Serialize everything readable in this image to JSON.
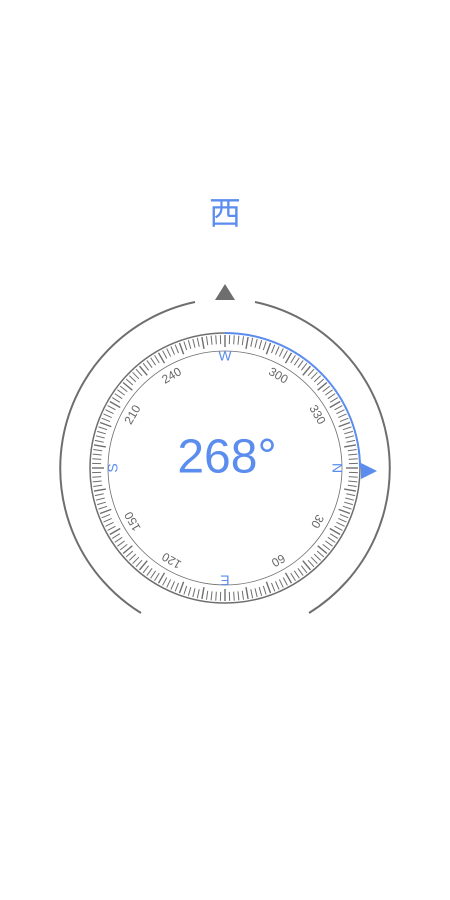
{
  "compass": {
    "direction_label": "西",
    "heading_degrees": 268,
    "heading_text": "268°",
    "cardinals": {
      "north": "N",
      "east": "E",
      "south": "S",
      "west": "W"
    },
    "degree_labels": [
      "30",
      "60",
      "120",
      "150",
      "210",
      "240",
      "300",
      "330"
    ],
    "colors": {
      "accent": "#5b8def",
      "ring": "#6e6e6e",
      "tick": "#6e6e6e",
      "label": "#666666",
      "pointer": "#6e6e6e"
    },
    "icons": {
      "top_pointer": "triangle-up-icon",
      "north_pointer": "triangle-right-icon"
    }
  }
}
